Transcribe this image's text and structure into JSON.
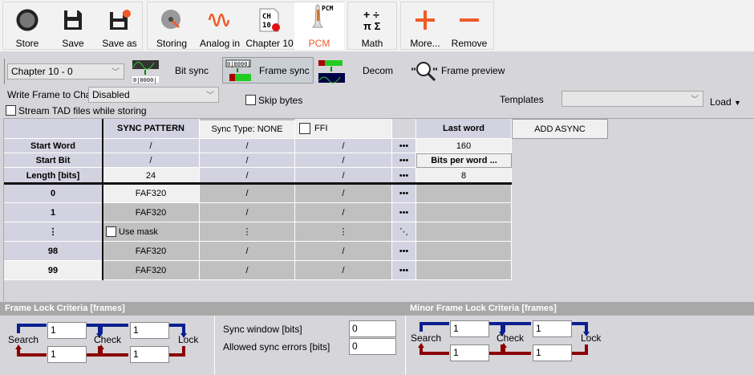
{
  "toolbar": {
    "store": "Store",
    "save": "Save",
    "save_as": "Save as",
    "storing": "Storing",
    "analog_in": "Analog in",
    "chapter10": "Chapter 10",
    "pcm": "PCM",
    "pcm_icon_text": "PCM",
    "ch10_icon_text": "CH 10",
    "math": "Math",
    "more": "More...",
    "remove": "Remove"
  },
  "colors": {
    "accent": "#f05a28",
    "active_label": "#f05a28",
    "header_cell": "#d3d2e0",
    "gray_cell": "#c0c0c0",
    "search_arrow": "#0a1f8f",
    "fail_arrow": "#8b0000"
  },
  "channel_select": {
    "value": "Chapter 10 - 0"
  },
  "steps": {
    "bit_sync": "Bit sync",
    "frame_sync": "Frame sync",
    "decom": "Decom",
    "frame_preview": "Frame preview"
  },
  "options": {
    "write_frame_label": "Write Frame to Channel",
    "write_frame_value": "Disabled",
    "skip_bytes": "Skip bytes",
    "stream_tad": "Stream TAD files while storing",
    "templates_label": "Templates",
    "templates_value": "",
    "load": "Load"
  },
  "grid": {
    "header": [
      "",
      "SYNC PATTERN",
      "Sync Type: NONE",
      "FFI",
      "",
      "Last word",
      "ADD ASYNC"
    ],
    "rows": [
      [
        "Start Word",
        "/",
        "/",
        "/",
        "•••",
        "160"
      ],
      [
        "Start Bit",
        "/",
        "/",
        "/",
        "•••",
        "Bits per word ..."
      ],
      [
        "Length [bits]",
        "24",
        "/",
        "/",
        "•••",
        "8"
      ],
      [
        "0",
        "FAF320",
        "/",
        "/",
        "•••",
        ""
      ],
      [
        "1",
        "FAF320",
        "/",
        "/",
        "•••",
        ""
      ],
      [
        "⋮",
        "Use mask",
        "⋮",
        "⋮",
        "⋱",
        ""
      ],
      [
        "98",
        "FAF320",
        "/",
        "/",
        "•••",
        ""
      ],
      [
        "99",
        "FAF320",
        "/",
        "/",
        "•••",
        ""
      ]
    ]
  },
  "frame_lock": {
    "title": "Frame Lock Criteria [frames]",
    "search": "Search",
    "check": "Check",
    "lock": "Lock",
    "search_to_check": "1",
    "check_to_lock": "1",
    "check_to_search": "1",
    "lock_to_check": "1"
  },
  "sync": {
    "window_label": "Sync window [bits]",
    "window_value": "0",
    "errors_label": "Allowed sync errors [bits]",
    "errors_value": "0"
  },
  "minor_lock": {
    "title": "Minor Frame Lock Criteria [frames]",
    "search": "Search",
    "check": "Check",
    "lock": "Lock",
    "search_to_check": "1",
    "check_to_lock": "1",
    "check_to_search": "1",
    "lock_to_check": "1"
  }
}
